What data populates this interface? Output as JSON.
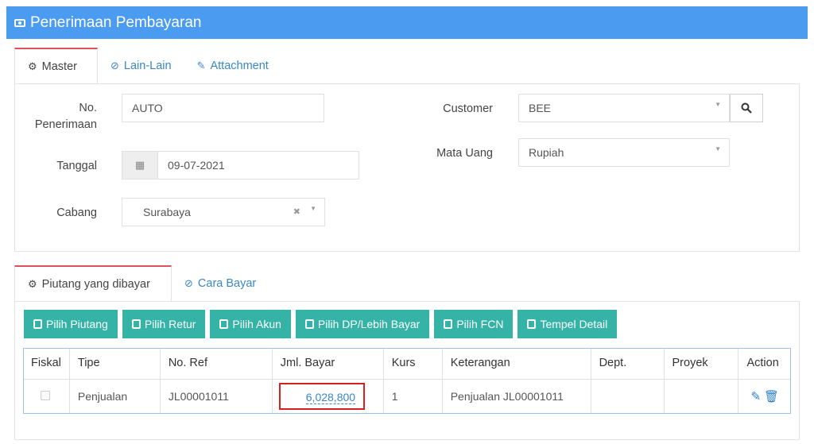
{
  "header": {
    "title": "Penerimaan Pembayaran",
    "icon": "money-icon"
  },
  "tabs_top": [
    {
      "label": "Master",
      "icon": "gears-icon",
      "active": true
    },
    {
      "label": "Lain-Lain",
      "icon": "check-circle-icon",
      "active": false
    },
    {
      "label": "Attachment",
      "icon": "paperclip-icon",
      "active": false
    }
  ],
  "form": {
    "no_penerimaan": {
      "label_line1": "No.",
      "label_line2": "Penerimaan",
      "value": "AUTO"
    },
    "tanggal": {
      "label": "Tanggal",
      "value": "09-07-2021"
    },
    "cabang": {
      "label": "Cabang",
      "value": "Surabaya"
    },
    "customer": {
      "label": "Customer",
      "value": "BEE"
    },
    "mata_uang": {
      "label": "Mata Uang",
      "value": "Rupiah"
    }
  },
  "tabs_bottom": [
    {
      "label": "Piutang yang dibayar",
      "icon": "gears-icon",
      "active": true
    },
    {
      "label": "Cara Bayar",
      "icon": "check-circle-icon",
      "active": false
    }
  ],
  "toolbar": [
    {
      "label": "Pilih Piutang"
    },
    {
      "label": "Pilih Retur"
    },
    {
      "label": "Pilih Akun"
    },
    {
      "label": "Pilih DP/Lebih Bayar"
    },
    {
      "label": "Pilih FCN"
    },
    {
      "label": "Tempel Detail"
    }
  ],
  "table": {
    "columns": [
      "Fiskal",
      "Tipe",
      "No. Ref",
      "Jml. Bayar",
      "Kurs",
      "Keterangan",
      "Dept.",
      "Proyek",
      "Action"
    ],
    "rows": [
      {
        "fiskal": false,
        "tipe": "Penjualan",
        "no_ref": "JL00001011",
        "jml_bayar": "6,028,800",
        "kurs": "1",
        "keterangan": "Penjualan JL00001011",
        "dept": "",
        "proyek": ""
      }
    ]
  },
  "colors": {
    "header": "#4b9bf1",
    "button": "#35b3a7",
    "tab_accent": "#e0525a",
    "link": "#3a87c8",
    "highlight": "#d82020"
  }
}
